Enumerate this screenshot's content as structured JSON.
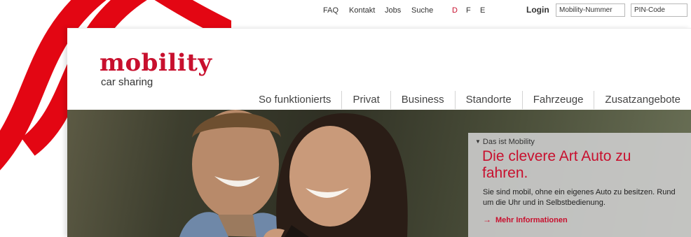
{
  "topnav": {
    "links": [
      "FAQ",
      "Kontakt",
      "Jobs",
      "Suche"
    ],
    "languages": [
      "D",
      "F",
      "E"
    ],
    "active_language": "D"
  },
  "login": {
    "label": "Login",
    "mobility_number_placeholder": "Mobility-Nummer",
    "pin_placeholder": "PIN-Code"
  },
  "logo": {
    "wordmark": "mobility",
    "tagline": "car sharing"
  },
  "nav": {
    "items": [
      "So funktionierts",
      "Privat",
      "Business",
      "Standorte",
      "Fahrzeuge",
      "Zusatzangebote"
    ]
  },
  "hero": {
    "eyebrow": "Das ist Mobility",
    "headline": "Die clevere Art Auto zu fahren.",
    "text": "Sie sind mobil, ohne ein eigenes Auto zu besitzen. Rund um die Uhr und in Selbstbedienung.",
    "link_label": "Mehr Informationen"
  },
  "colors": {
    "brand_red": "#c8102e"
  }
}
